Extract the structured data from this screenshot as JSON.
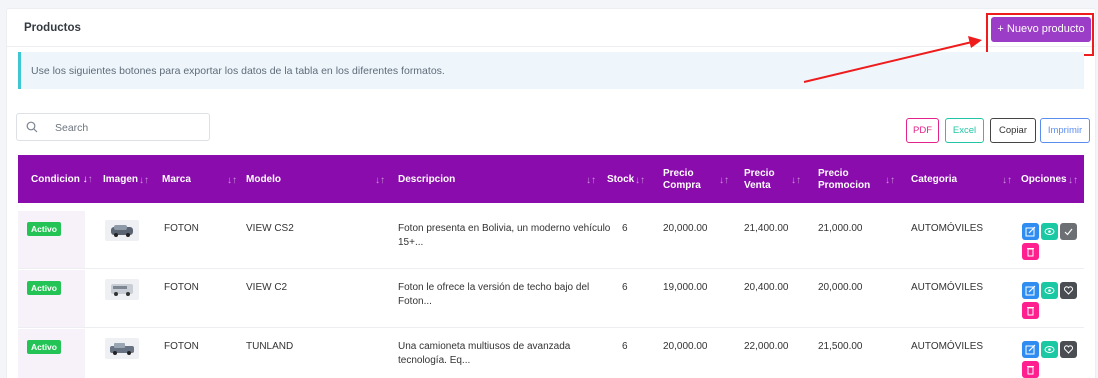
{
  "card": {
    "title": "Productos",
    "new_button": "+ Nuevo producto"
  },
  "info": {
    "text": "Use los siguientes botones para exportar los datos de la tabla en los diferentes formatos."
  },
  "search": {
    "placeholder": "Search"
  },
  "export": {
    "pdf": "PDF",
    "excel": "Excel",
    "copy": "Copiar",
    "print": "Imprimir"
  },
  "table": {
    "headers": {
      "condicion": "Condicion",
      "imagen": "Imagen",
      "marca": "Marca",
      "modelo": "Modelo",
      "descripcion": "Descripcion",
      "stock": "Stock",
      "precio_compra_1": "Precio",
      "precio_compra_2": "Compra",
      "precio_venta_1": "Precio",
      "precio_venta_2": "Venta",
      "precio_promocion_1": "Precio",
      "precio_promocion_2": "Promocion",
      "categoria": "Categoria",
      "opciones": "Opciones"
    },
    "rows": [
      {
        "condicion": "Activo",
        "marca": "FOTON",
        "modelo": "VIEW CS2",
        "descripcion_1": "Foton presenta en Bolivia, un moderno vehículo",
        "descripcion_2": "15+...",
        "stock": "6",
        "precio_compra": "20,000.00",
        "precio_venta": "21,400.00",
        "precio_promocion": "21,000.00",
        "categoria": "AUTOMÓVILES",
        "toggle_icon": "check-icon"
      },
      {
        "condicion": "Activo",
        "marca": "FOTON",
        "modelo": "VIEW C2",
        "descripcion_1": "Foton le ofrece la versión de techo bajo del",
        "descripcion_2": "Foton...",
        "stock": "6",
        "precio_compra": "19,000.00",
        "precio_venta": "20,400.00",
        "precio_promocion": "20,000.00",
        "categoria": "AUTOMÓVILES",
        "toggle_icon": "heart-icon"
      },
      {
        "condicion": "Activo",
        "marca": "FOTON",
        "modelo": "TUNLAND",
        "descripcion_1": "Una camioneta multiusos de avanzada",
        "descripcion_2": "tecnología. Eq...",
        "stock": "6",
        "precio_compra": "20,000.00",
        "precio_venta": "22,000.00",
        "precio_promocion": "21,500.00",
        "categoria": "AUTOMÓVILES",
        "toggle_icon": "heart-icon"
      }
    ]
  },
  "colors": {
    "primary": "#9b3dc6",
    "table_header": "#8a0cac",
    "active_badge": "#23c455",
    "edit_button": "#2f8cf0",
    "view_button": "#1ac9a4",
    "toggle_button": "#6c6f73",
    "delete_button": "#ff1f8e",
    "highlight": "#ee1c1c"
  }
}
